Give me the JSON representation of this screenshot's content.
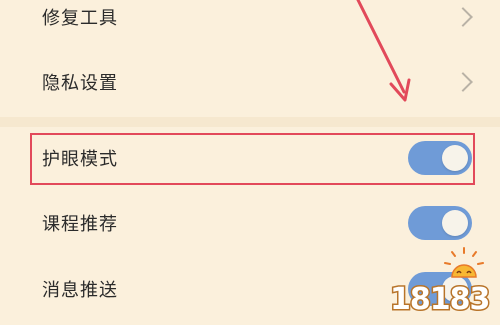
{
  "settings": {
    "items": [
      {
        "label": "修复工具",
        "type": "link"
      },
      {
        "label": "隐私设置",
        "type": "link"
      },
      {
        "label": "护眼模式",
        "type": "toggle",
        "enabled": true
      },
      {
        "label": "课程推荐",
        "type": "toggle",
        "enabled": true
      },
      {
        "label": "消息推送",
        "type": "toggle",
        "enabled": true
      }
    ]
  },
  "annotation": {
    "highlight_color": "#e2495a",
    "highlighted_item": "护眼模式"
  },
  "colors": {
    "background": "#fbf0dc",
    "toggle_on": "#6f9bd7",
    "chevron": "#b9b2a6"
  },
  "watermark": {
    "text": "18183"
  }
}
